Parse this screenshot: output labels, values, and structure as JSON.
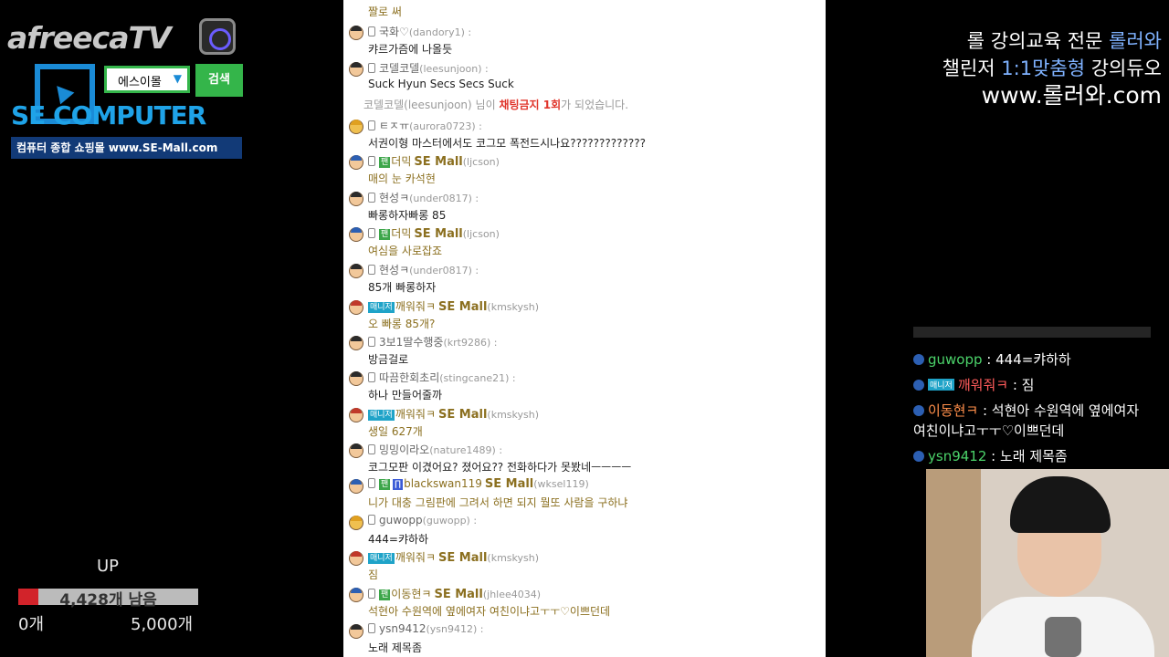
{
  "ad": {
    "logo": "afreecaTV",
    "select_value": "에스이몰",
    "search_label": "검색",
    "brand": "SE COMPUTER",
    "tagline": "컴퓨터 종합 쇼핑몰 www.SE-Mall.com"
  },
  "goal": {
    "label": "UP",
    "remaining_text": "4,428개 남음",
    "min": "0개",
    "max": "5,000개",
    "progress_fraction": 0.114
  },
  "chat": {
    "top_text": "짤로 써",
    "system_notice": {
      "user": "코델코델(leesunjoon) 님이",
      "highlight": "채팅금지 1회",
      "suffix": "가 되었습니다."
    },
    "messages": [
      {
        "nick": "국화♡",
        "uid": "(dandory1) :",
        "text": "캬르가즘에 나올듯"
      },
      {
        "nick": "코델코델",
        "uid": "(leesunjoon) :",
        "text": "Suck Hyun Secs Secs Suck"
      },
      {
        "nick": "ㅌㅈㅠ",
        "uid": "(aurora0723) :",
        "text": "서권이형 마스터에서도 코그모 폭전드시나요?????????????"
      },
      {
        "nick": "더믹",
        "semall": "SE Mall",
        "uid": "(ljcson)",
        "text": "매의 눈 카석현"
      },
      {
        "nick": "현성ㅋ",
        "uid": "(under0817) :",
        "text": "빠롱하자빠롱 85"
      },
      {
        "nick": "더믹",
        "semall": "SE Mall",
        "uid": "(ljcson)",
        "text": "여심을 사로잡죠"
      },
      {
        "nick": "현성ㅋ",
        "uid": "(under0817) :",
        "text": "85개 빠롱하자"
      },
      {
        "badge": "매니저",
        "nick": "깨워줘ㅋ",
        "semall": "SE Mall",
        "uid": "(kmskysh)",
        "text": "오 빠롱 85개?"
      },
      {
        "nick": "3보1딸수행중",
        "uid": "(krt9286) :",
        "text": "방금걸로"
      },
      {
        "nick": "따끔한회초리",
        "uid": "(stingcane21) :",
        "text": "하나 만들어줄까"
      },
      {
        "badge": "매니저",
        "nick": "깨워줘ㅋ",
        "semall": "SE Mall",
        "uid": "(kmskysh)",
        "text": "생일 627개"
      },
      {
        "nick": "밍밍이라오",
        "uid": "(nature1489) :",
        "text": "코그모판 이겼어요? 졌어요?? 전화하다가 못봤네ㅡㅡㅡㅡ"
      },
      {
        "nick": "blackswan119",
        "semall": "SE Mall",
        "uid": "(wksel119)",
        "text": "니가 대충 그림판에 그려서 하면 되지 뭘또 사람을 구하냐"
      },
      {
        "nick": "guwopp",
        "uid": "(guwopp) :",
        "text": "444=캬하하"
      },
      {
        "badge": "매니저",
        "nick": "깨워줘ㅋ",
        "semall": "SE Mall",
        "uid": "(kmskysh)",
        "text": "짐"
      },
      {
        "nick": "이동현ㅋ",
        "semall": "SE Mall",
        "uid": "(jhlee4034)",
        "text": "석현아 수원역에 옆에여자 여친이냐고ㅜㅜ♡이쁘던데"
      },
      {
        "nick": "ysn9412",
        "uid": "(ysn9412) :",
        "text": "노래 제목좀"
      }
    ]
  },
  "promo": {
    "line1_a": "롤 강의교육 전문 ",
    "line1_b": "롤러와",
    "line2_a": "챌린저 ",
    "line2_b": "1:1맞춤형",
    "line2_c": " 강의듀오",
    "line3": "www.롤러와.com"
  },
  "overlay": [
    {
      "nick": "guwopp",
      "sep": " : ",
      "text": "444=캬하하"
    },
    {
      "badge": "매니저",
      "nick": "깨워줘ㅋ",
      "sep": " : ",
      "text": "짐"
    },
    {
      "nick": "이동현ㅋ",
      "sep": " : ",
      "text": "석현아 수원역에 옆에여자",
      "text2": "여친이냐고ㅜㅜ♡이쁘던데"
    },
    {
      "nick": "ysn9412",
      "sep": " : ",
      "text": "노래 제목좀"
    }
  ]
}
